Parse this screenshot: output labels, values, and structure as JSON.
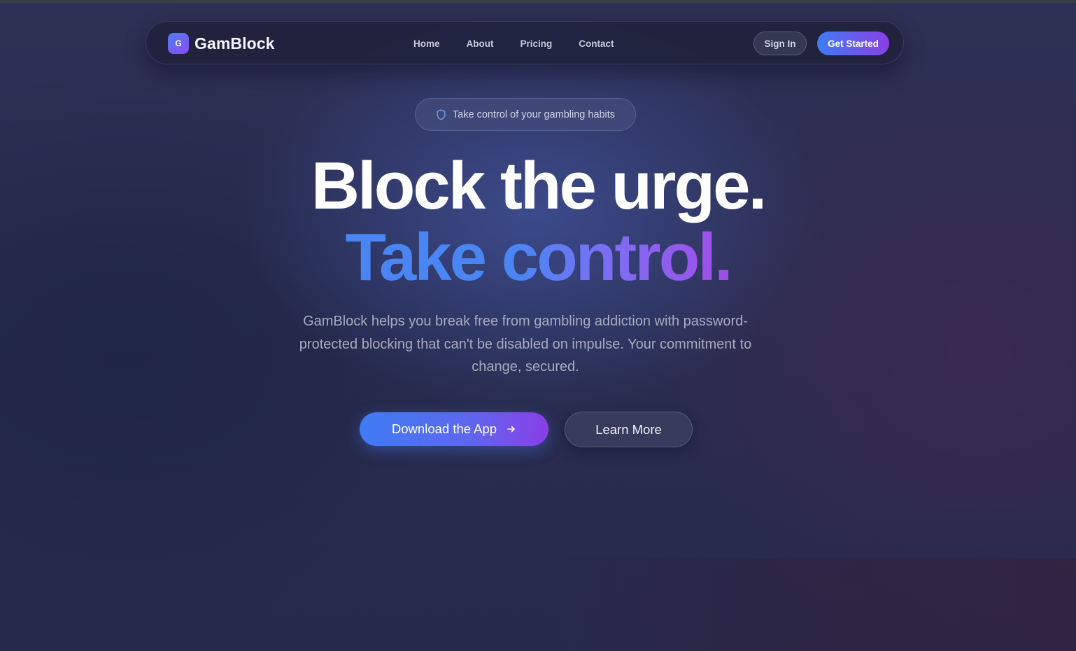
{
  "nav": {
    "logo_letter": "G",
    "brand": "GamBlock",
    "links": [
      "Home",
      "About",
      "Pricing",
      "Contact"
    ],
    "sign_in": "Sign In",
    "get_started": "Get Started"
  },
  "hero": {
    "badge_text": "Take control of your gambling habits",
    "badge_icon": "shield-icon",
    "headline_line1": "Block the urge.",
    "headline_line2": "Take control.",
    "description": "GamBlock helps you break free from gambling addiction with password-protected blocking that can't be disabled on impulse. Your commitment to change, secured.",
    "cta_primary": "Download the App",
    "cta_primary_icon": "arrow-right-icon",
    "cta_secondary": "Learn More"
  },
  "colors": {
    "background": "#2a2d50",
    "accent_blue": "#3f7cf4",
    "accent_purple": "#8a3fe6"
  }
}
